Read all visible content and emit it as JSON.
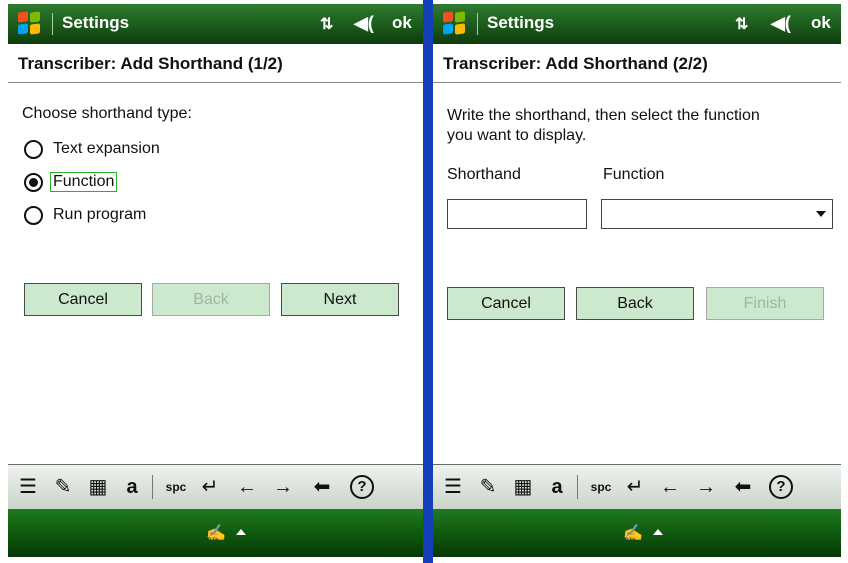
{
  "screens": [
    {
      "title": "Settings",
      "ok": "ok",
      "page_title": "Transcriber: Add Shorthand (1/2)",
      "prompt": "Choose shorthand type:",
      "radios": [
        {
          "label": "Text expansion",
          "selected": false
        },
        {
          "label": "Function",
          "selected": true
        },
        {
          "label": "Run program",
          "selected": false
        }
      ],
      "buttons": [
        {
          "label": "Cancel",
          "enabled": true
        },
        {
          "label": "Back",
          "enabled": false
        },
        {
          "label": "Next",
          "enabled": true
        }
      ]
    },
    {
      "title": "Settings",
      "ok": "ok",
      "page_title": "Transcriber: Add Shorthand (2/2)",
      "prompt_line1": "Write the shorthand, then select the function",
      "prompt_line2": "you want to display.",
      "shorthand_label": "Shorthand",
      "shorthand_value": "",
      "function_label": "Function",
      "function_value": "",
      "buttons": [
        {
          "label": "Cancel",
          "enabled": true
        },
        {
          "label": "Back",
          "enabled": true
        },
        {
          "label": "Finish",
          "enabled": false
        }
      ]
    }
  ],
  "toolbar": {
    "letter": "a",
    "space": "spc",
    "enter": "↵",
    "left": "←",
    "right": "→",
    "backspace": "⬅",
    "help": "?"
  },
  "bottom": {
    "sip_icon": "✍"
  },
  "colors": {
    "titlebar": "#1b5a1b",
    "button_bg": "#cde9cd",
    "divider": "#1340b8",
    "focus": "#2bb12b"
  }
}
